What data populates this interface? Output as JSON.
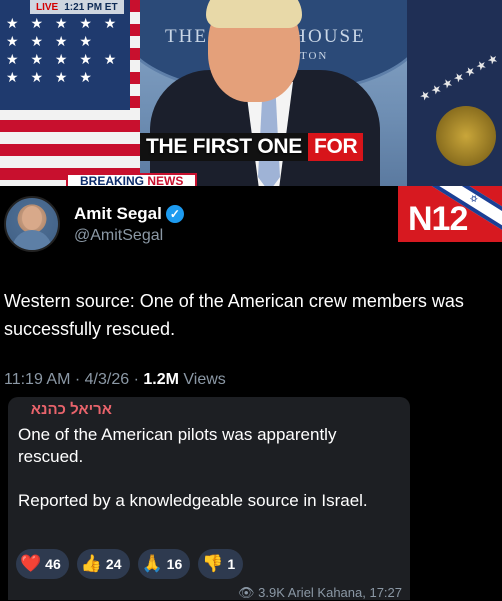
{
  "video": {
    "live_label": "LIVE",
    "time": "1:21 PM ET",
    "backdrop_text": "THE WHITE HOUSE",
    "backdrop_subtext": "GTON",
    "caption_plain": "THE FIRST ONE",
    "caption_highlight": "FOR",
    "breaking": "BREAKING",
    "news": "NEWS"
  },
  "channel": {
    "logo": "N12"
  },
  "tweet": {
    "name": "Amit Segal",
    "handle": "@AmitSegal",
    "text": "Western source: One of the American crew members was successfully rescued.",
    "time": "11:19 AM",
    "date": "4/3/26",
    "views_count": "1.2M",
    "views_label": "Views"
  },
  "message": {
    "author": "אריאל כהנא",
    "line1": "One of the American pilots was apparently rescued.",
    "line2": "Reported by a knowledgeable source in Israel.",
    "reactions": [
      {
        "emoji": "❤️",
        "count": "46"
      },
      {
        "emoji": "👍",
        "count": "24"
      },
      {
        "emoji": "🙏",
        "count": "16"
      },
      {
        "emoji": "👎",
        "count": "1"
      }
    ],
    "footer": "👁 3.9K  Ariel Kahana, 17:27"
  },
  "colors": {
    "accent_red": "#d71920",
    "verified_blue": "#1d9bf0",
    "bubble_bg": "#1d1f23"
  }
}
